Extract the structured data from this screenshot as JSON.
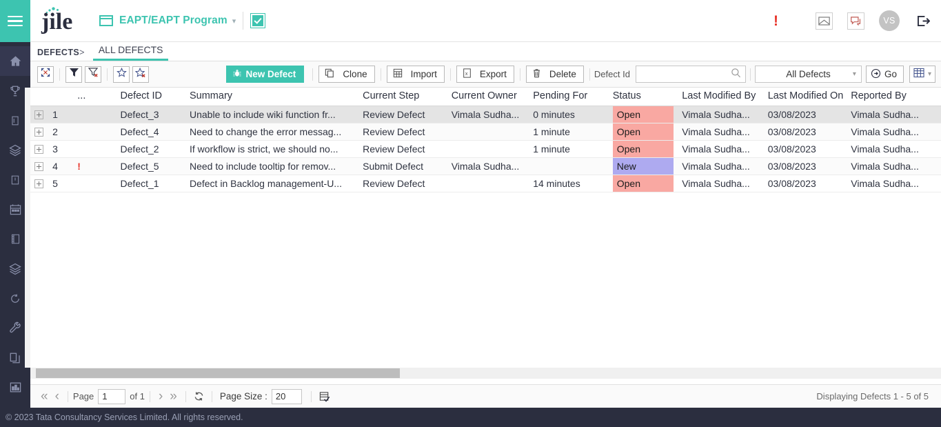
{
  "header": {
    "menu_icon": "hamburger-icon",
    "logo_text": "jile",
    "project_icon": "project-board-icon",
    "project_name": "EAPT/EAPT Program",
    "project_caret": "chevron-down-icon",
    "check_icon": "checkbox-checked-icon",
    "alert_icon": "!",
    "mail_icon": "envelope-icon",
    "chat_icon": "chat-bubble-icon",
    "avatar_initials": "VS",
    "logout_icon": "logout-icon"
  },
  "sidebar": {
    "items": [
      {
        "name": "home",
        "icon": "home-icon",
        "active": true
      },
      {
        "name": "goals",
        "icon": "trophy-icon",
        "active": false
      },
      {
        "name": "board",
        "icon": "card-icon",
        "active": false
      },
      {
        "name": "backlog",
        "icon": "layers-icon",
        "active": false
      },
      {
        "name": "story",
        "icon": "note-icon",
        "active": false
      },
      {
        "name": "calendar",
        "icon": "calendar-icon",
        "active": false
      },
      {
        "name": "notebook",
        "icon": "book-icon",
        "active": false
      },
      {
        "name": "releases",
        "icon": "stack-icon",
        "active": false
      },
      {
        "name": "iterations",
        "icon": "refresh-circle-icon",
        "active": false
      },
      {
        "name": "tools",
        "icon": "wrench-icon",
        "active": false
      },
      {
        "name": "documents",
        "icon": "copy-pages-icon",
        "active": false
      },
      {
        "name": "reports",
        "icon": "bar-chart-icon",
        "active": false
      }
    ]
  },
  "tabstrip": {
    "breadcrumb": "DEFECTS",
    "breadcrumb_sep": ">",
    "tabs": [
      {
        "label": "ALL DEFECTS",
        "active": true
      }
    ]
  },
  "toolbar": {
    "icon_buttons": [
      {
        "name": "expand-collapse-button",
        "icon": "expand-arrows-icon"
      },
      {
        "name": "filter-button",
        "icon": "funnel-icon"
      },
      {
        "name": "clear-filter-button",
        "icon": "funnel-clear-icon"
      },
      {
        "name": "favorite-button",
        "icon": "star-icon"
      },
      {
        "name": "clear-favorite-button",
        "icon": "star-clear-icon"
      }
    ],
    "new_defect_label": "New Defect",
    "new_defect_icon": "bug-icon",
    "clone_label": "Clone",
    "clone_icon": "copy-icon",
    "import_label": "Import",
    "import_icon": "import-sheet-icon",
    "export_label": "Export",
    "export_icon": "excel-export-icon",
    "delete_label": "Delete",
    "delete_icon": "trash-icon",
    "search_label": "Defect Id",
    "search_value": "",
    "search_placeholder": "",
    "search_icon": "magnifier-icon",
    "view_selected": "All Defects",
    "view_caret": "chevron-down-icon",
    "go_label": "Go",
    "go_icon": "arrow-right-circle-icon",
    "grid_icon": "grid-view-icon",
    "grid_caret": "chevron-down-icon"
  },
  "grid": {
    "columns": [
      {
        "key": "expand",
        "label": ""
      },
      {
        "key": "index",
        "label": ""
      },
      {
        "key": "dots",
        "label": "..."
      },
      {
        "key": "defect_id",
        "label": "Defect ID"
      },
      {
        "key": "summary",
        "label": "Summary"
      },
      {
        "key": "current_step",
        "label": "Current Step"
      },
      {
        "key": "current_owner",
        "label": "Current Owner"
      },
      {
        "key": "pending_for",
        "label": "Pending For"
      },
      {
        "key": "status",
        "label": "Status"
      },
      {
        "key": "last_modified_by",
        "label": "Last Modified By"
      },
      {
        "key": "last_modified_on",
        "label": "Last Modified On"
      },
      {
        "key": "reported_by",
        "label": "Reported By"
      }
    ],
    "rows": [
      {
        "index": "1",
        "flag": "",
        "defect_id": "Defect_3",
        "summary": "Unable to include wiki function fr...",
        "current_step": "Review Defect",
        "current_owner": "Vimala Sudha...",
        "pending_for": "0 minutes",
        "status": "Open",
        "status_color": "#f9a8a2",
        "last_modified_by": "Vimala Sudha...",
        "last_modified_on": "03/08/2023",
        "reported_by": "Vimala Sudha...",
        "selected": true
      },
      {
        "index": "2",
        "flag": "",
        "defect_id": "Defect_4",
        "summary": "Need to change the error messag...",
        "current_step": "Review Defect",
        "current_owner": "",
        "pending_for": "1 minute",
        "status": "Open",
        "status_color": "#f9a8a2",
        "last_modified_by": "Vimala Sudha...",
        "last_modified_on": "03/08/2023",
        "reported_by": "Vimala Sudha...",
        "selected": false
      },
      {
        "index": "3",
        "flag": "",
        "defect_id": "Defect_2",
        "summary": "If workflow is strict, we should no...",
        "current_step": "Review Defect",
        "current_owner": "",
        "pending_for": "1 minute",
        "status": "Open",
        "status_color": "#f9a8a2",
        "last_modified_by": "Vimala Sudha...",
        "last_modified_on": "03/08/2023",
        "reported_by": "Vimala Sudha...",
        "selected": false
      },
      {
        "index": "4",
        "flag": "!",
        "defect_id": "Defect_5",
        "summary": "Need to include tooltip for remov...",
        "current_step": "Submit Defect",
        "current_owner": "Vimala Sudha...",
        "pending_for": "",
        "status": "New",
        "status_color": "#aeaaf0",
        "last_modified_by": "Vimala Sudha...",
        "last_modified_on": "03/08/2023",
        "reported_by": "Vimala Sudha...",
        "selected": false
      },
      {
        "index": "5",
        "flag": "",
        "defect_id": "Defect_1",
        "summary": "Defect in Backlog management-U...",
        "current_step": "Review Defect",
        "current_owner": "",
        "pending_for": "14 minutes",
        "status": "Open",
        "status_color": "#f9a8a2",
        "last_modified_by": "Vimala Sudha...",
        "last_modified_on": "03/08/2023",
        "reported_by": "Vimala Sudha...",
        "selected": false
      }
    ]
  },
  "pager": {
    "first_icon": "double-chevron-left-icon",
    "prev_icon": "chevron-left-icon",
    "page_label": "Page",
    "page_value": "1",
    "of_label": "of 1",
    "next_icon": "chevron-right-icon",
    "last_icon": "double-chevron-right-icon",
    "refresh_icon": "refresh-icon",
    "page_size_label": "Page Size :",
    "page_size_value": "20",
    "columns_icon": "column-chooser-icon",
    "displaying": "Displaying Defects 1 - 5 of 5"
  },
  "footer": {
    "copyright": "© 2023 Tata Consultancy Services Limited. All rights reserved."
  },
  "theme": {
    "accent": "#3dc4b0",
    "rail_bg": "#2b2e3f",
    "status_open": "#f9a8a2",
    "status_new": "#aeaaf0",
    "link": "#4a7ebb"
  }
}
